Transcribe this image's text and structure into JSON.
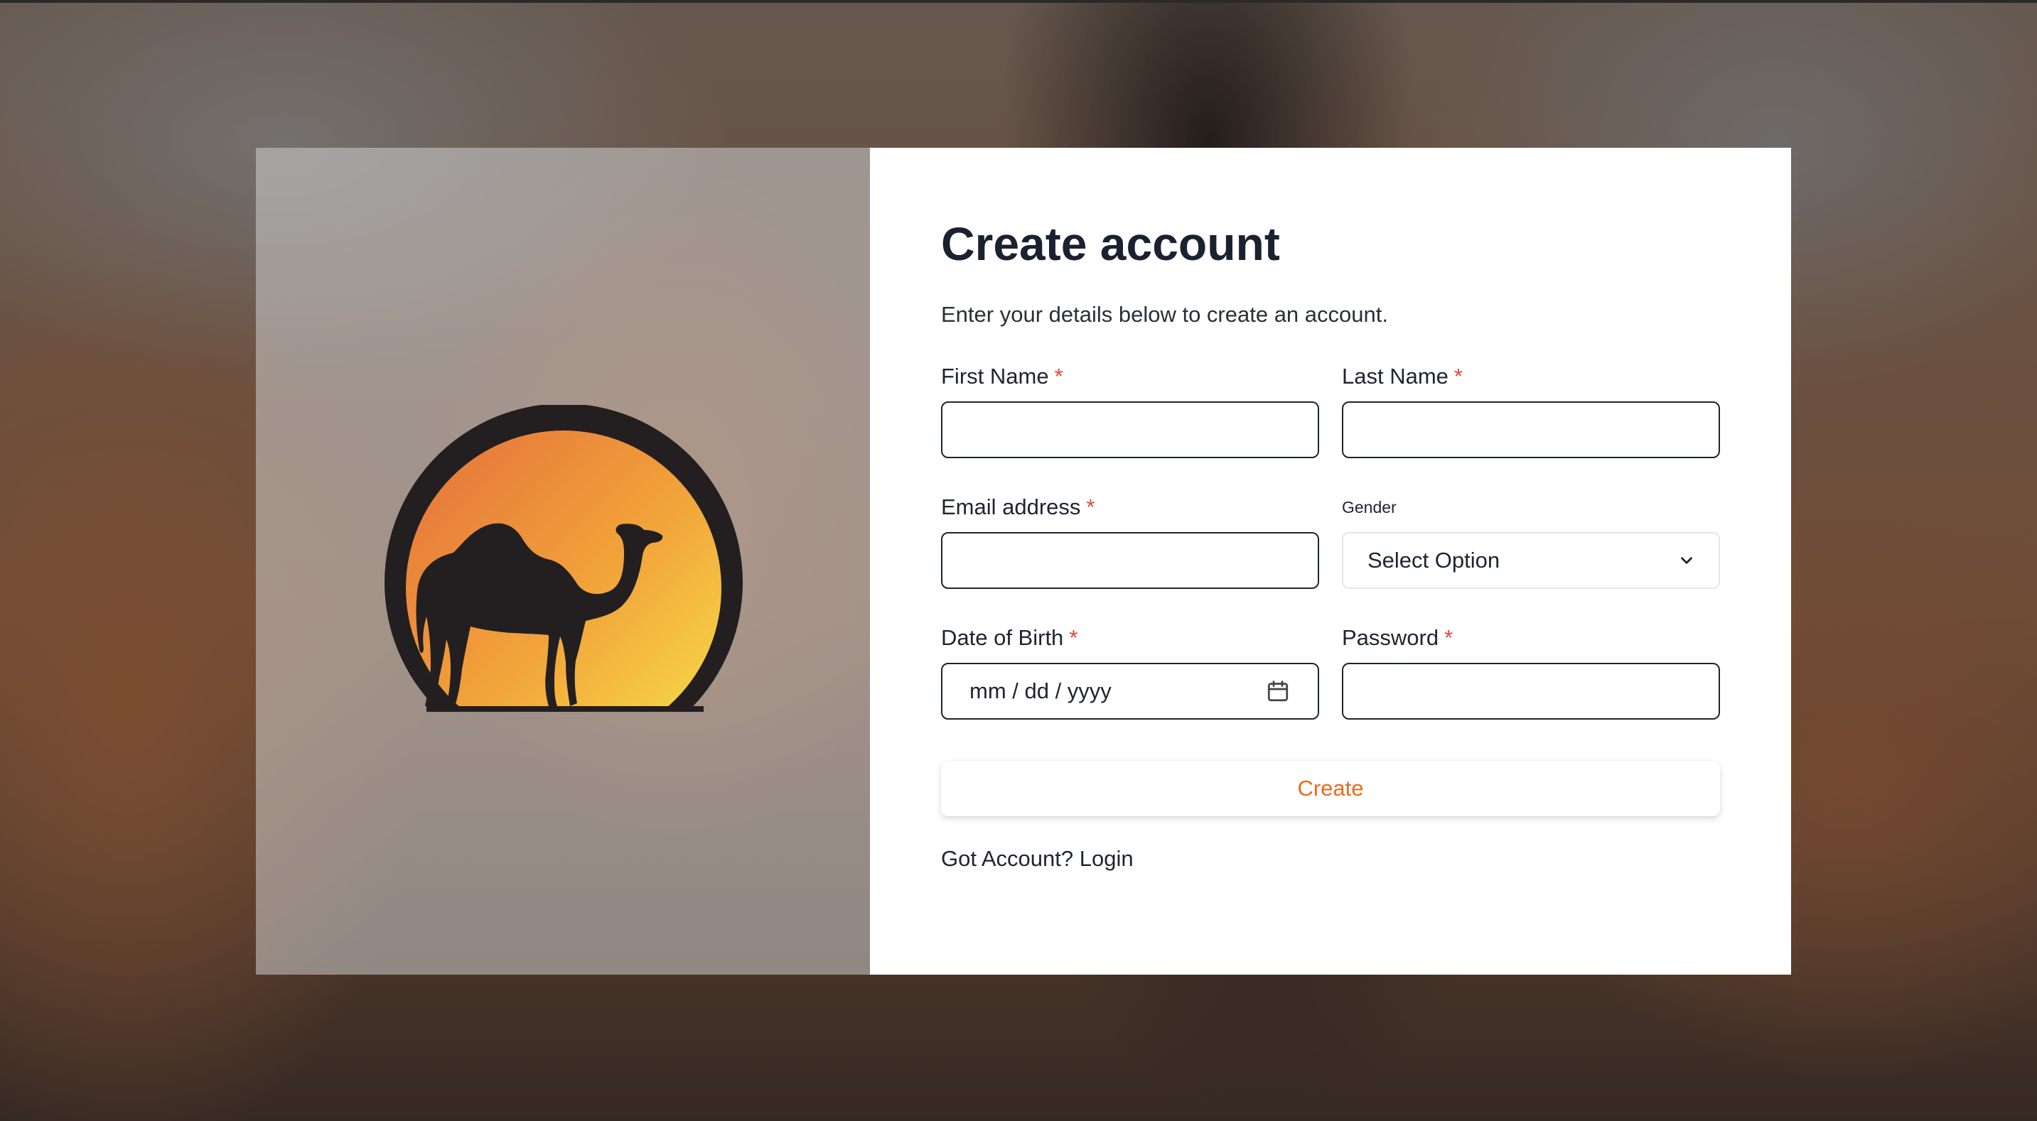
{
  "form": {
    "title": "Create account",
    "subtitle": "Enter your details below to create an account.",
    "required_marker": "*",
    "fields": {
      "first_name": {
        "label": "First Name",
        "value": ""
      },
      "last_name": {
        "label": "Last Name",
        "value": ""
      },
      "email": {
        "label": "Email address",
        "value": ""
      },
      "gender": {
        "label": "Gender",
        "selected": "Select Option"
      },
      "dob": {
        "label": "Date of Birth",
        "placeholder": "mm / dd / yyyy"
      },
      "password": {
        "label": "Password",
        "value": ""
      }
    },
    "submit_label": "Create",
    "login_prompt": "Got Account?",
    "login_link": "Login"
  },
  "brand": {
    "logo_icon": "camel-sunset-logo-icon",
    "accent_color": "#ec6a1c",
    "required_color": "#e0473a"
  }
}
